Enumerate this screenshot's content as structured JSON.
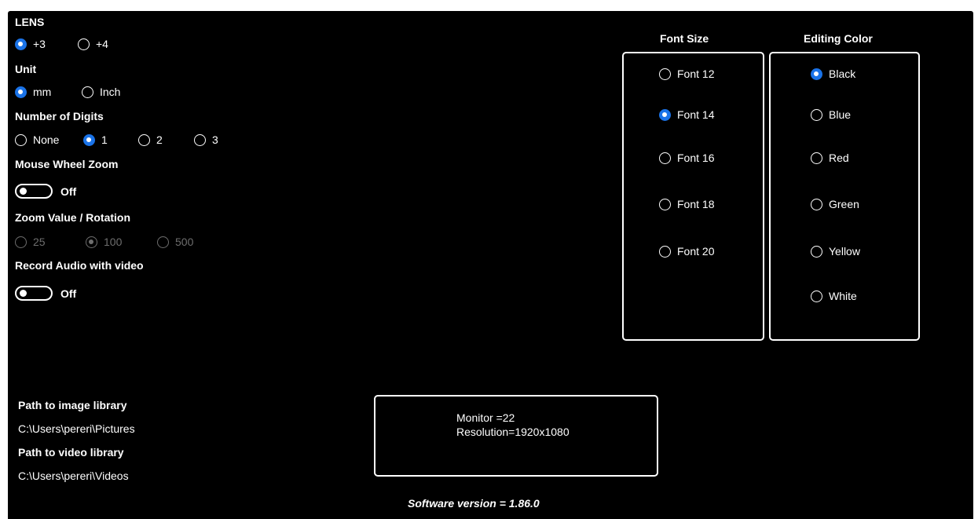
{
  "lens": {
    "label": "LENS",
    "options": [
      "+3",
      "+4"
    ],
    "selected": "+3"
  },
  "unit": {
    "label": "Unit",
    "options": [
      "mm",
      "Inch"
    ],
    "selected": "mm"
  },
  "digits": {
    "label": "Number of Digits",
    "options": [
      "None",
      "1",
      "2",
      "3"
    ],
    "selected": "1"
  },
  "mouse_wheel_zoom": {
    "label": "Mouse Wheel Zoom",
    "state": "Off"
  },
  "zoom_value": {
    "label": "Zoom Value / Rotation",
    "options": [
      "25",
      "100",
      "500"
    ],
    "selected": "100",
    "enabled": false
  },
  "record_audio": {
    "label": "Record Audio with video",
    "state": "Off"
  },
  "font_size": {
    "label": "Font Size",
    "options": [
      "Font 12",
      "Font 14",
      "Font 16",
      "Font 18",
      "Font 20"
    ],
    "selected": "Font 14"
  },
  "editing_color": {
    "label": "Editing Color",
    "options": [
      "Black",
      "Blue",
      "Red",
      "Green",
      "Yellow",
      "White"
    ],
    "selected": "Black"
  },
  "paths": {
    "image_label": "Path to image library",
    "image_value": "C:\\Users\\pereri\\Pictures",
    "video_label": "Path to video library",
    "video_value": "C:\\Users\\pereri\\Videos"
  },
  "monitor_info": {
    "monitor": "Monitor =22",
    "resolution": "Resolution=1920x1080"
  },
  "software_version": "Software version = 1.86.0",
  "colors": {
    "background": "#000000",
    "foreground": "#ffffff",
    "accent": "#1a73e8",
    "disabled": "#6e6e6e"
  }
}
